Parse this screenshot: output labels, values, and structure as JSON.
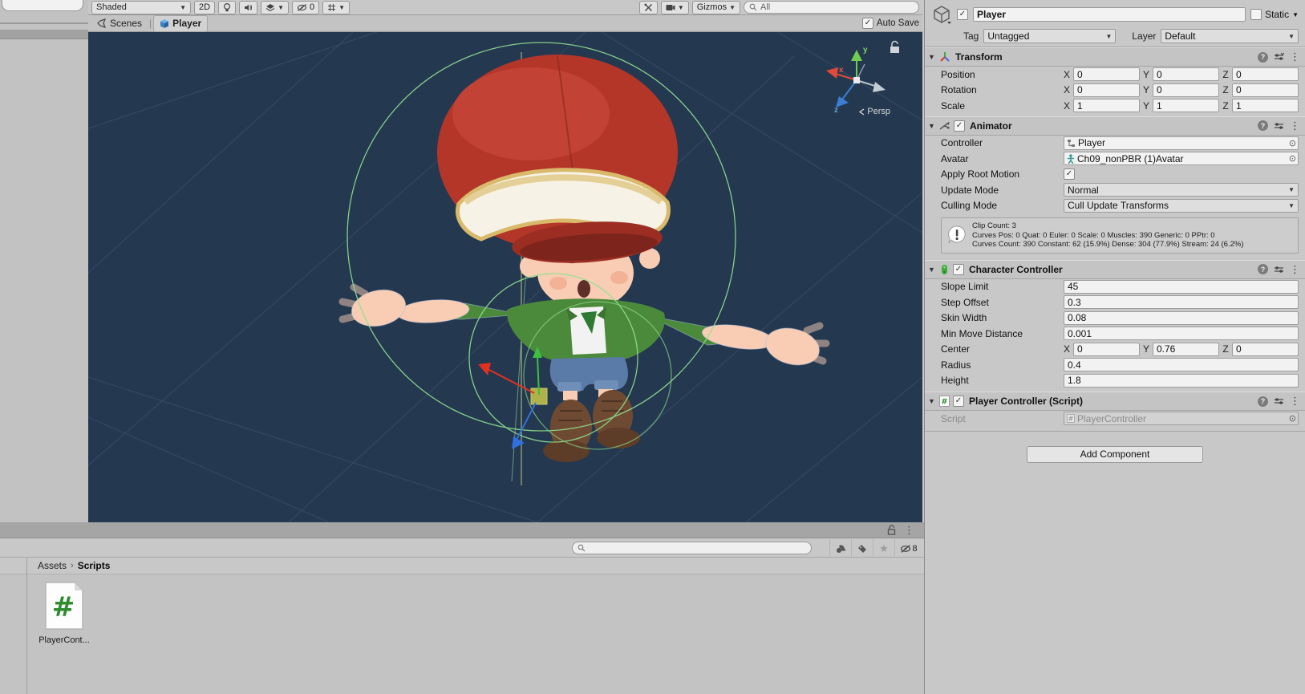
{
  "scene_toolbar": {
    "shading_mode": "Shaded",
    "toggle_2d": "2D",
    "hidden_count": "0",
    "gizmos_label": "Gizmos",
    "search_value": "All"
  },
  "tabs": {
    "scenes": "Scenes",
    "player": "Player",
    "auto_save": "Auto Save"
  },
  "scene_view": {
    "persp_label": "Persp",
    "axis": {
      "x": "x",
      "y": "y",
      "z": "z"
    }
  },
  "inspector": {
    "header": {
      "name": "Player",
      "static_label": "Static",
      "tag_label": "Tag",
      "tag_value": "Untagged",
      "layer_label": "Layer",
      "layer_value": "Default"
    },
    "transform": {
      "title": "Transform",
      "rows": [
        {
          "label": "Position",
          "x": "0",
          "y": "0",
          "z": "0"
        },
        {
          "label": "Rotation",
          "x": "0",
          "y": "0",
          "z": "0"
        },
        {
          "label": "Scale",
          "x": "1",
          "y": "1",
          "z": "1"
        }
      ],
      "axis_labels": {
        "x": "X",
        "y": "Y",
        "z": "Z"
      }
    },
    "animator": {
      "title": "Animator",
      "controller_label": "Controller",
      "controller_value": "Player",
      "avatar_label": "Avatar",
      "avatar_value": "Ch09_nonPBR (1)Avatar",
      "apply_root_motion_label": "Apply Root Motion",
      "update_mode_label": "Update Mode",
      "update_mode_value": "Normal",
      "culling_mode_label": "Culling Mode",
      "culling_mode_value": "Cull Update Transforms",
      "info_lines": [
        "Clip Count: 3",
        "Curves Pos: 0 Quat: 0 Euler: 0 Scale: 0 Muscles: 390 Generic: 0 PPtr: 0",
        "Curves Count: 390 Constant: 62 (15.9%) Dense: 304 (77.9%) Stream: 24 (6.2%)"
      ]
    },
    "character_controller": {
      "title": "Character Controller",
      "rows": [
        {
          "label": "Slope Limit",
          "value": "45"
        },
        {
          "label": "Step Offset",
          "value": "0.3"
        },
        {
          "label": "Skin Width",
          "value": "0.08"
        },
        {
          "label": "Min Move Distance",
          "value": "0.001"
        }
      ],
      "center": {
        "label": "Center",
        "x": "0",
        "y": "0.76",
        "z": "0"
      },
      "rows2": [
        {
          "label": "Radius",
          "value": "0.4"
        },
        {
          "label": "Height",
          "value": "1.8"
        }
      ]
    },
    "script_component": {
      "title": "Player Controller (Script)",
      "script_label": "Script",
      "script_value": "PlayerController"
    },
    "add_component_label": "Add Component"
  },
  "project": {
    "breadcrumb_root": "Assets",
    "breadcrumb_current": "Scripts",
    "file_label": "PlayerCont...",
    "hidden_count": "8"
  },
  "colors": {
    "scene_bg": "#243850",
    "gizmo_green": "#8fe08f",
    "cap_red": "#b43629",
    "jacket_green": "#4b8a3b",
    "cube_blue": "#4a9ee8"
  }
}
